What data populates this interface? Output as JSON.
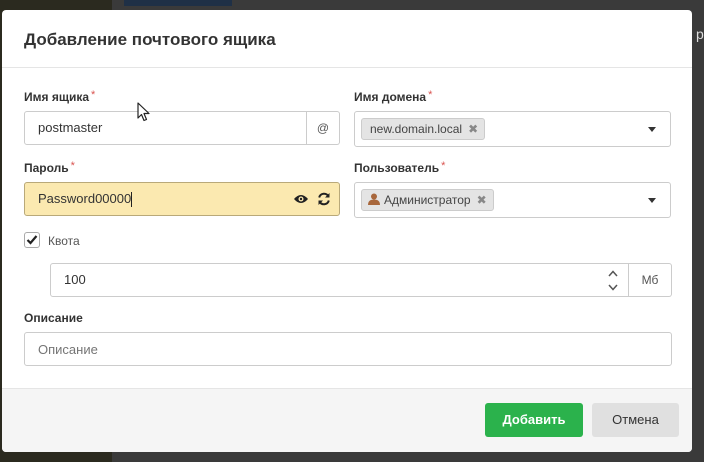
{
  "background": {
    "right_text": "р"
  },
  "modal": {
    "title": "Добавление почтового ящика",
    "mailbox": {
      "label": "Имя ящика",
      "value": "postmaster",
      "addon": "@"
    },
    "domain": {
      "label": "Имя домена",
      "tag": "new.domain.local",
      "tag_remove": "✖"
    },
    "password": {
      "label": "Пароль",
      "value": "Password00000",
      "show_icon": "eye-icon",
      "generate_icon": "refresh-icon"
    },
    "user": {
      "label": "Пользователь",
      "tag": "Администратор",
      "tag_remove": "✖",
      "tag_icon": "user-icon"
    },
    "quota": {
      "label": "Квота",
      "checked": true,
      "value": "100",
      "unit": "Мб"
    },
    "description": {
      "label": "Описание",
      "placeholder": "Описание"
    },
    "required_mark": "*",
    "buttons": {
      "add": "Добавить",
      "cancel": "Отмена"
    },
    "colors": {
      "accent_green": "#2bb24c",
      "password_bg": "#fbe9b0",
      "required": "#d9534f"
    }
  }
}
